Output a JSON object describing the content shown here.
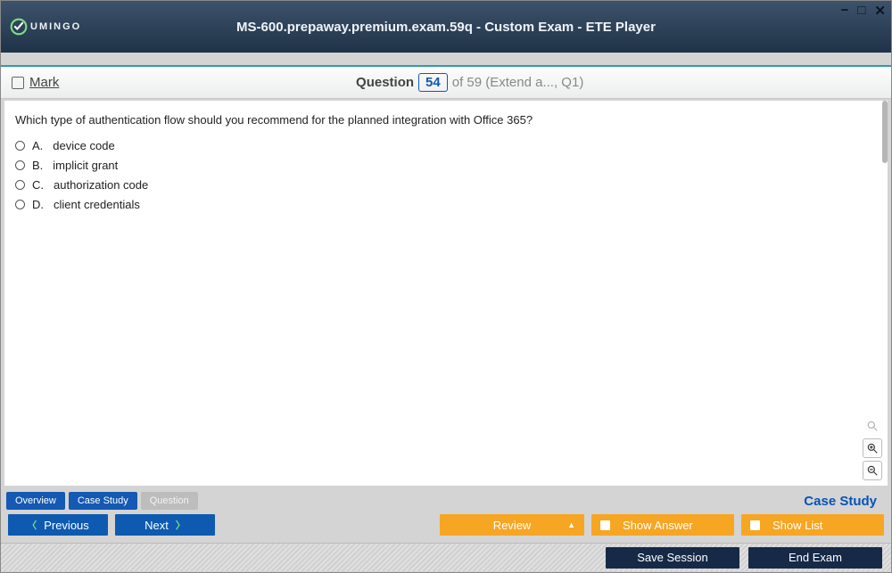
{
  "window": {
    "title": "MS-600.prepaway.premium.exam.59q - Custom Exam - ETE Player",
    "logo_text": "UMINGO"
  },
  "header": {
    "mark_label": "Mark",
    "question_label": "Question",
    "question_number": "54",
    "question_of": "of 59 (Extend a..., Q1)"
  },
  "question": {
    "text": "Which type of authentication flow should you recommend for the planned integration with Office 365?",
    "options": [
      {
        "letter": "A.",
        "text": "device code"
      },
      {
        "letter": "B.",
        "text": "implicit grant"
      },
      {
        "letter": "C.",
        "text": "authorization code"
      },
      {
        "letter": "D.",
        "text": "client credentials"
      }
    ]
  },
  "tabs": {
    "overview": "Overview",
    "case_study": "Case Study",
    "question": "Question",
    "right_label": "Case Study"
  },
  "nav": {
    "previous": "Previous",
    "next": "Next",
    "review": "Review",
    "show_answer": "Show Answer",
    "show_list": "Show List"
  },
  "bottom": {
    "save_session": "Save Session",
    "end_exam": "End Exam"
  }
}
